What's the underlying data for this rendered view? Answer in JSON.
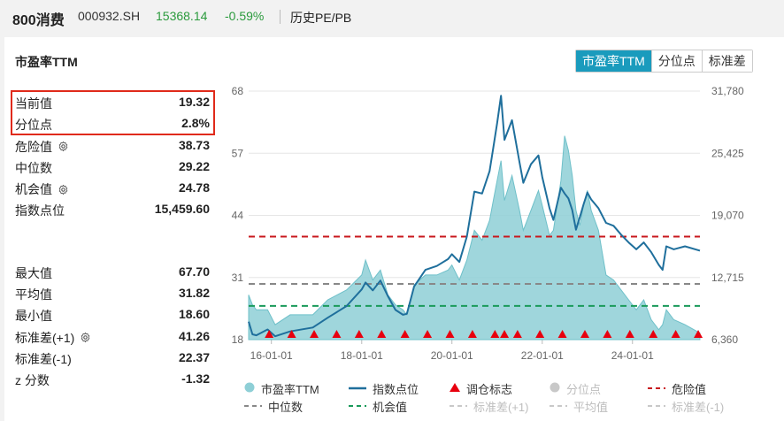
{
  "header": {
    "name": "800消费",
    "code": "000932.SH",
    "price": "15368.14",
    "change": "-0.59%",
    "link": "历史PE/PB"
  },
  "panel": {
    "title": "市盈率TTM",
    "tabs": [
      {
        "label": "市盈率TTM",
        "active": true
      },
      {
        "label": "分位点",
        "active": false
      },
      {
        "label": "标准差",
        "active": false
      }
    ]
  },
  "stats": {
    "top": [
      {
        "label": "当前值",
        "value": "19.32",
        "gear": false
      },
      {
        "label": "分位点",
        "value": "2.8%",
        "gear": false
      },
      {
        "label": "危险值",
        "value": "38.73",
        "gear": true
      },
      {
        "label": "中位数",
        "value": "29.22",
        "gear": false
      },
      {
        "label": "机会值",
        "value": "24.78",
        "gear": true
      },
      {
        "label": "指数点位",
        "value": "15,459.60",
        "gear": false
      }
    ],
    "bottom": [
      {
        "label": "最大值",
        "value": "67.70",
        "gear": false
      },
      {
        "label": "平均值",
        "value": "31.82",
        "gear": false
      },
      {
        "label": "最小值",
        "value": "18.60",
        "gear": false
      },
      {
        "label": "标准差(+1)",
        "value": "41.26",
        "gear": true
      },
      {
        "label": "标准差(-1)",
        "value": "22.37",
        "gear": false
      },
      {
        "label": "z 分数",
        "value": "-1.32",
        "gear": false
      }
    ]
  },
  "colors": {
    "pe": "#8ecfd6",
    "index": "#1f6f9c",
    "danger": "#c8191e",
    "median": "#888888",
    "opportunity": "#1a9a5a",
    "marker": "#e8000e",
    "faded": "#c8c8c8",
    "accent": "#1a9bbd"
  },
  "chart_data": {
    "type": "area",
    "x_ticks": [
      "16-01-01",
      "18-01-01",
      "20-01-01",
      "22-01-01",
      "24-01-01"
    ],
    "y_left_ticks": [
      "68",
      "57",
      "44",
      "31",
      "18"
    ],
    "y_right_ticks": [
      "31,780",
      "25,425",
      "19,070",
      "12,715",
      "6,360"
    ],
    "y_left_range": [
      18,
      68
    ],
    "y_right_range": [
      6360,
      31780
    ],
    "x_range": [
      "2015-07-01",
      "2025-06-30"
    ],
    "series": [
      {
        "name": "市盈率TTM",
        "axis": "left",
        "points": [
          [
            "2015-07-01",
            27
          ],
          [
            "2015-08-01",
            25
          ],
          [
            "2015-09-01",
            24
          ],
          [
            "2015-12-01",
            24
          ],
          [
            "2016-02-01",
            21
          ],
          [
            "2016-06-01",
            23
          ],
          [
            "2016-12-01",
            23
          ],
          [
            "2017-04-01",
            26
          ],
          [
            "2017-09-01",
            28
          ],
          [
            "2018-01-01",
            31
          ],
          [
            "2018-02-01",
            34
          ],
          [
            "2018-04-01",
            30
          ],
          [
            "2018-06-01",
            32
          ],
          [
            "2018-08-01",
            27
          ],
          [
            "2018-10-01",
            25
          ],
          [
            "2018-12-01",
            24
          ],
          [
            "2019-01-01",
            23
          ],
          [
            "2019-03-01",
            29
          ],
          [
            "2019-06-01",
            31
          ],
          [
            "2019-09-01",
            31
          ],
          [
            "2019-12-01",
            32
          ],
          [
            "2020-01-01",
            33
          ],
          [
            "2020-03-01",
            30
          ],
          [
            "2020-05-01",
            34
          ],
          [
            "2020-07-01",
            40
          ],
          [
            "2020-09-01",
            38
          ],
          [
            "2020-11-01",
            42
          ],
          [
            "2020-12-01",
            46
          ],
          [
            "2021-01-01",
            50
          ],
          [
            "2021-02-01",
            54
          ],
          [
            "2021-03-01",
            46
          ],
          [
            "2021-05-01",
            51
          ],
          [
            "2021-07-01",
            44
          ],
          [
            "2021-08-01",
            40
          ],
          [
            "2021-10-01",
            44
          ],
          [
            "2021-12-01",
            48
          ],
          [
            "2022-01-01",
            45
          ],
          [
            "2022-03-01",
            39
          ],
          [
            "2022-04-01",
            40
          ],
          [
            "2022-06-01",
            50
          ],
          [
            "2022-07-01",
            59
          ],
          [
            "2022-08-01",
            56
          ],
          [
            "2022-09-01",
            51
          ],
          [
            "2022-10-01",
            44
          ],
          [
            "2022-11-01",
            41
          ],
          [
            "2022-12-01",
            45
          ],
          [
            "2023-01-01",
            48
          ],
          [
            "2023-02-01",
            44
          ],
          [
            "2023-04-01",
            40
          ],
          [
            "2023-06-01",
            31
          ],
          [
            "2023-08-01",
            30
          ],
          [
            "2023-10-01",
            28
          ],
          [
            "2023-12-01",
            26
          ],
          [
            "2024-02-01",
            24
          ],
          [
            "2024-04-01",
            26
          ],
          [
            "2024-06-01",
            22
          ],
          [
            "2024-08-01",
            20
          ],
          [
            "2024-09-01",
            21
          ],
          [
            "2024-10-01",
            24
          ],
          [
            "2024-12-01",
            22
          ],
          [
            "2025-03-01",
            21
          ],
          [
            "2025-06-30",
            19.32
          ]
        ]
      },
      {
        "name": "指数点位",
        "axis": "right",
        "points": [
          [
            "2015-07-01",
            8200
          ],
          [
            "2015-08-01",
            6900
          ],
          [
            "2015-09-01",
            6800
          ],
          [
            "2015-12-01",
            7400
          ],
          [
            "2016-02-01",
            6700
          ],
          [
            "2016-06-01",
            7200
          ],
          [
            "2016-12-01",
            7600
          ],
          [
            "2017-04-01",
            8600
          ],
          [
            "2017-09-01",
            9800
          ],
          [
            "2018-01-01",
            11500
          ],
          [
            "2018-02-01",
            12200
          ],
          [
            "2018-04-01",
            11400
          ],
          [
            "2018-06-01",
            12400
          ],
          [
            "2018-08-01",
            10800
          ],
          [
            "2018-10-01",
            9400
          ],
          [
            "2018-12-01",
            8900
          ],
          [
            "2019-01-01",
            9000
          ],
          [
            "2019-03-01",
            11800
          ],
          [
            "2019-06-01",
            13500
          ],
          [
            "2019-09-01",
            13900
          ],
          [
            "2019-12-01",
            14600
          ],
          [
            "2020-01-01",
            15100
          ],
          [
            "2020-03-01",
            14300
          ],
          [
            "2020-05-01",
            16900
          ],
          [
            "2020-07-01",
            21500
          ],
          [
            "2020-09-01",
            21300
          ],
          [
            "2020-11-01",
            23600
          ],
          [
            "2020-12-01",
            26000
          ],
          [
            "2021-01-01",
            28500
          ],
          [
            "2021-02-01",
            31300
          ],
          [
            "2021-03-01",
            26800
          ],
          [
            "2021-05-01",
            28800
          ],
          [
            "2021-07-01",
            24500
          ],
          [
            "2021-08-01",
            22400
          ],
          [
            "2021-10-01",
            24300
          ],
          [
            "2021-12-01",
            25200
          ],
          [
            "2022-01-01",
            23000
          ],
          [
            "2022-03-01",
            19800
          ],
          [
            "2022-04-01",
            18600
          ],
          [
            "2022-06-01",
            21900
          ],
          [
            "2022-07-01",
            21300
          ],
          [
            "2022-08-01",
            20800
          ],
          [
            "2022-09-01",
            19600
          ],
          [
            "2022-10-01",
            17600
          ],
          [
            "2022-11-01",
            18900
          ],
          [
            "2022-12-01",
            20200
          ],
          [
            "2023-01-01",
            21400
          ],
          [
            "2023-02-01",
            20700
          ],
          [
            "2023-04-01",
            19800
          ],
          [
            "2023-06-01",
            18300
          ],
          [
            "2023-08-01",
            18000
          ],
          [
            "2023-10-01",
            17100
          ],
          [
            "2023-12-01",
            16300
          ],
          [
            "2024-02-01",
            15600
          ],
          [
            "2024-04-01",
            16300
          ],
          [
            "2024-06-01",
            15300
          ],
          [
            "2024-08-01",
            14000
          ],
          [
            "2024-09-01",
            13500
          ],
          [
            "2024-10-01",
            15900
          ],
          [
            "2024-12-01",
            15600
          ],
          [
            "2025-03-01",
            15900
          ],
          [
            "2025-06-30",
            15459.6
          ]
        ]
      }
    ],
    "reference_lines": [
      {
        "name": "危险值",
        "value": 38.73,
        "style": "dashed"
      },
      {
        "name": "中位数",
        "value": 29.22,
        "style": "dashed"
      },
      {
        "name": "机会值",
        "value": 24.78,
        "style": "dashed"
      }
    ],
    "rebalance_markers": [
      "2015-12-14",
      "2016-06-13",
      "2016-12-12",
      "2017-06-12",
      "2017-12-11",
      "2018-06-11",
      "2018-12-17",
      "2019-06-17",
      "2019-12-16",
      "2020-06-15",
      "2020-12-14",
      "2021-03-01",
      "2021-06-15",
      "2021-12-13",
      "2022-06-13",
      "2022-12-12",
      "2023-06-12",
      "2023-12-11",
      "2024-06-17",
      "2024-12-16",
      "2025-06-16"
    ],
    "legend": [
      {
        "label": "市盈率TTM",
        "symbol": "dot",
        "color": "#8ecfd6"
      },
      {
        "label": "指数点位",
        "symbol": "line",
        "color": "#1f6f9c"
      },
      {
        "label": "调仓标志",
        "symbol": "triangle",
        "color": "#e8000e"
      },
      {
        "label": "分位点",
        "symbol": "dot",
        "color": "#c8c8c8",
        "faded": true
      },
      {
        "label": "危险值",
        "symbol": "dash",
        "color": "#c8191e"
      },
      {
        "label": "中位数",
        "symbol": "dash",
        "color": "#888888"
      },
      {
        "label": "机会值",
        "symbol": "dash",
        "color": "#1a9a5a"
      },
      {
        "label": "标准差(+1)",
        "symbol": "dash",
        "color": "#c8c8c8",
        "faded": true
      },
      {
        "label": "平均值",
        "symbol": "dash",
        "color": "#c8c8c8",
        "faded": true
      },
      {
        "label": "标准差(-1)",
        "symbol": "dash",
        "color": "#c8c8c8",
        "faded": true
      }
    ]
  }
}
